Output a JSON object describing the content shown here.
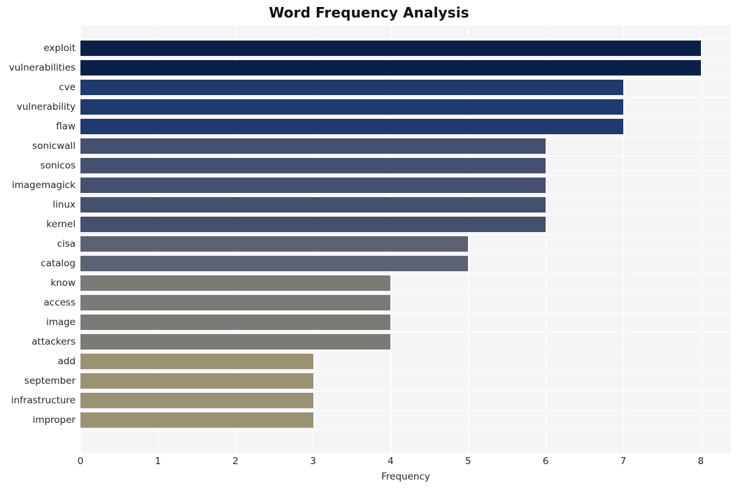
{
  "chart_data": {
    "type": "bar",
    "orientation": "horizontal",
    "title": "Word Frequency Analysis",
    "xlabel": "Frequency",
    "ylabel": "",
    "categories": [
      "exploit",
      "vulnerabilities",
      "cve",
      "vulnerability",
      "flaw",
      "sonicwall",
      "sonicos",
      "imagemagick",
      "linux",
      "kernel",
      "cisa",
      "catalog",
      "know",
      "access",
      "image",
      "attackers",
      "add",
      "september",
      "infrastructure",
      "improper"
    ],
    "values": [
      8,
      8,
      7,
      7,
      7,
      6,
      6,
      6,
      6,
      6,
      5,
      5,
      4,
      4,
      4,
      4,
      3,
      3,
      3,
      3
    ],
    "bar_colors": [
      "#0b2049",
      "#0b2049",
      "#1e3a6e",
      "#1e3a6e",
      "#1e3a6e",
      "#44506f",
      "#44506f",
      "#44506f",
      "#44506f",
      "#44506f",
      "#5d6273",
      "#5d6273",
      "#7b7a77",
      "#7b7a77",
      "#7b7a77",
      "#7b7a77",
      "#9b9271",
      "#9b9271",
      "#9b9271",
      "#9b9271"
    ],
    "xlim": [
      0,
      8.39
    ],
    "xticks": [
      0,
      1,
      2,
      3,
      4,
      5,
      6,
      7,
      8
    ],
    "xtick_labels": [
      "0",
      "1",
      "2",
      "3",
      "4",
      "5",
      "6",
      "7",
      "8"
    ],
    "grid": true,
    "grid_color": "#ffffff",
    "plot_background": "#f5f5f6",
    "figure_background": "#ffffff",
    "legend": null
  }
}
